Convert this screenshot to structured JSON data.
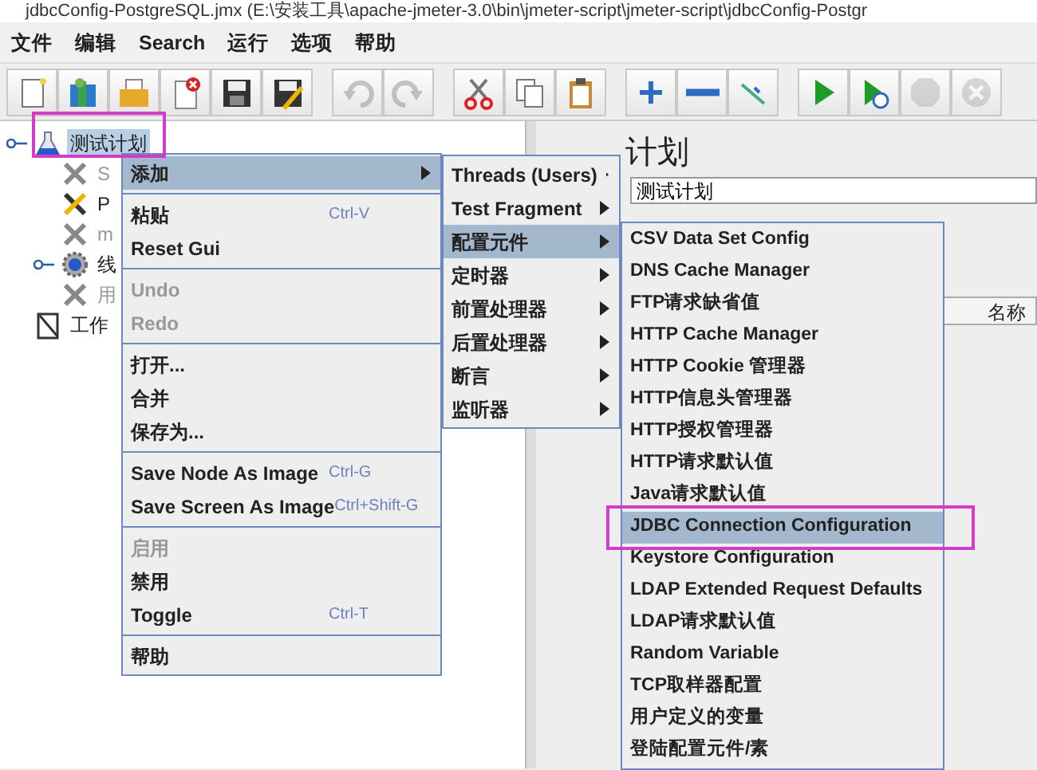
{
  "window": {
    "title": "jdbcConfig-PostgreSQL.jmx (E:\\安装工具\\apache-jmeter-3.0\\bin\\jmeter-script\\jmeter-script\\jdbcConfig-Postgr"
  },
  "menubar": [
    "文件",
    "编辑",
    "Search",
    "运行",
    "选项",
    "帮助"
  ],
  "toolbar": [
    [
      {
        "kind": "new",
        "disabled": false
      },
      {
        "kind": "templates",
        "disabled": false
      },
      {
        "kind": "open",
        "disabled": false
      },
      {
        "kind": "close",
        "disabled": false
      },
      {
        "kind": "save",
        "disabled": false
      },
      {
        "kind": "save-as",
        "disabled": false
      }
    ],
    [
      {
        "kind": "undo",
        "disabled": true
      },
      {
        "kind": "redo",
        "disabled": true
      }
    ],
    [
      {
        "kind": "cut",
        "disabled": false
      },
      {
        "kind": "copy",
        "disabled": false
      },
      {
        "kind": "paste",
        "disabled": false
      }
    ],
    [
      {
        "kind": "expand",
        "disabled": false
      },
      {
        "kind": "collapse",
        "disabled": false
      },
      {
        "kind": "toggle",
        "disabled": false
      }
    ],
    [
      {
        "kind": "start",
        "disabled": false
      },
      {
        "kind": "start-no-pause",
        "disabled": false
      },
      {
        "kind": "stop",
        "disabled": true
      },
      {
        "kind": "shutdown",
        "disabled": true
      }
    ]
  ],
  "tree": [
    {
      "label": "测试计划",
      "kind": "plan",
      "selected": true,
      "disabled": false,
      "expandable": true,
      "annotated": true,
      "children": [
        {
          "label": "S",
          "kind": "config",
          "selected": false,
          "disabled": true,
          "expandable": false,
          "annotated": false
        },
        {
          "label": "P",
          "kind": "config",
          "selected": false,
          "disabled": false,
          "expandable": false,
          "annotated": false
        },
        {
          "label": "m",
          "kind": "config",
          "selected": false,
          "disabled": true,
          "expandable": false,
          "annotated": false
        },
        {
          "label": "线",
          "kind": "threads",
          "selected": false,
          "disabled": false,
          "expandable": true,
          "annotated": false
        },
        {
          "label": "用",
          "kind": "config",
          "selected": false,
          "disabled": true,
          "expandable": false,
          "annotated": false
        }
      ]
    },
    {
      "label": "工作",
      "kind": "workbench",
      "selected": false,
      "disabled": false,
      "expandable": false,
      "annotated": false
    }
  ],
  "editor": {
    "heading": "计划",
    "name_value": "测试计划",
    "column_header": "名称"
  },
  "context_menu": [
    {
      "kind": "item",
      "label": "添加",
      "disabled": false,
      "selected": true,
      "submenu": true
    },
    {
      "kind": "separator"
    },
    {
      "kind": "item",
      "label": "粘贴",
      "shortcut": "Ctrl-V",
      "disabled": false,
      "selected": false,
      "submenu": false
    },
    {
      "kind": "item",
      "label": "Reset Gui",
      "disabled": false,
      "selected": false,
      "submenu": false
    },
    {
      "kind": "separator"
    },
    {
      "kind": "item",
      "label": "Undo",
      "disabled": true,
      "selected": false,
      "submenu": false
    },
    {
      "kind": "item",
      "label": "Redo",
      "disabled": true,
      "selected": false,
      "submenu": false
    },
    {
      "kind": "separator"
    },
    {
      "kind": "item",
      "label": "打开...",
      "disabled": false,
      "selected": false,
      "submenu": false
    },
    {
      "kind": "item",
      "label": "合并",
      "disabled": false,
      "selected": false,
      "submenu": false
    },
    {
      "kind": "item",
      "label": "保存为...",
      "disabled": false,
      "selected": false,
      "submenu": false
    },
    {
      "kind": "separator"
    },
    {
      "kind": "item",
      "label": "Save Node As Image",
      "shortcut": "Ctrl-G",
      "disabled": false,
      "selected": false,
      "submenu": false
    },
    {
      "kind": "item",
      "label": "Save Screen As Image",
      "shortcut": "Ctrl+Shift-G",
      "disabled": false,
      "selected": false,
      "submenu": false
    },
    {
      "kind": "separator"
    },
    {
      "kind": "item",
      "label": "启用",
      "disabled": true,
      "selected": false,
      "submenu": false
    },
    {
      "kind": "item",
      "label": "禁用",
      "disabled": false,
      "selected": false,
      "submenu": false
    },
    {
      "kind": "item",
      "label": "Toggle",
      "shortcut": "Ctrl-T",
      "disabled": false,
      "selected": false,
      "submenu": false
    },
    {
      "kind": "separator"
    },
    {
      "kind": "item",
      "label": "帮助",
      "disabled": false,
      "selected": false,
      "submenu": false
    }
  ],
  "add_submenu": [
    {
      "label": "Threads (Users)",
      "selected": false
    },
    {
      "label": "Test Fragment",
      "selected": false
    },
    {
      "label": "配置元件",
      "selected": true
    },
    {
      "label": "定时器",
      "selected": false
    },
    {
      "label": "前置处理器",
      "selected": false
    },
    {
      "label": "后置处理器",
      "selected": false
    },
    {
      "label": "断言",
      "selected": false
    },
    {
      "label": "监听器",
      "selected": false
    }
  ],
  "config_submenu": [
    {
      "label": "CSV Data Set Config",
      "selected": false,
      "annotated": false
    },
    {
      "label": "DNS Cache Manager",
      "selected": false,
      "annotated": false
    },
    {
      "label": "FTP请求缺省值",
      "selected": false,
      "annotated": false
    },
    {
      "label": "HTTP Cache Manager",
      "selected": false,
      "annotated": false
    },
    {
      "label": "HTTP Cookie 管理器",
      "selected": false,
      "annotated": false
    },
    {
      "label": "HTTP信息头管理器",
      "selected": false,
      "annotated": false
    },
    {
      "label": "HTTP授权管理器",
      "selected": false,
      "annotated": false
    },
    {
      "label": "HTTP请求默认值",
      "selected": false,
      "annotated": false
    },
    {
      "label": "Java请求默认值",
      "selected": false,
      "annotated": false
    },
    {
      "label": "JDBC Connection Configuration",
      "selected": true,
      "annotated": true
    },
    {
      "label": "Keystore Configuration",
      "selected": false,
      "annotated": false
    },
    {
      "label": "LDAP Extended Request Defaults",
      "selected": false,
      "annotated": false
    },
    {
      "label": "LDAP请求默认值",
      "selected": false,
      "annotated": false
    },
    {
      "label": "Random Variable",
      "selected": false,
      "annotated": false
    },
    {
      "label": "TCP取样器配置",
      "selected": false,
      "annotated": false
    },
    {
      "label": "用户定义的变量",
      "selected": false,
      "annotated": false
    },
    {
      "label": "登陆配置元件/素",
      "selected": false,
      "annotated": false
    }
  ]
}
